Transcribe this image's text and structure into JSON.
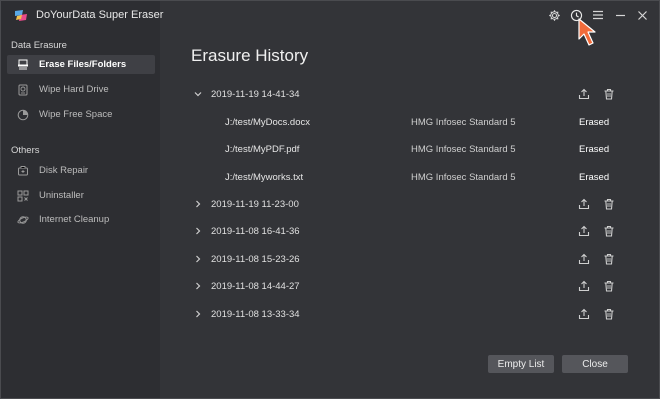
{
  "app": {
    "title": "DoYourData Super Eraser"
  },
  "sidebar": {
    "sections": [
      {
        "label": "Data Erasure"
      },
      {
        "label": "Others"
      }
    ],
    "items": [
      {
        "label": "Erase Files/Folders",
        "icon": "shredder-icon",
        "active": true
      },
      {
        "label": "Wipe Hard Drive",
        "icon": "hard-drive-icon",
        "active": false
      },
      {
        "label": "Wipe Free Space",
        "icon": "pie-chart-icon",
        "active": false
      },
      {
        "label": "Disk Repair",
        "icon": "disk-repair-icon",
        "active": false
      },
      {
        "label": "Uninstaller",
        "icon": "uninstaller-icon",
        "active": false
      },
      {
        "label": "Internet Cleanup",
        "icon": "planet-icon",
        "active": false
      }
    ]
  },
  "main": {
    "title": "Erasure History",
    "groups": [
      {
        "date": "2019-11-19 14-41-34",
        "expanded": true,
        "files": [
          {
            "path": "J:/test/MyDocs.docx",
            "algorithm": "HMG Infosec Standard 5",
            "status": "Erased"
          },
          {
            "path": "J:/test/MyPDF.pdf",
            "algorithm": "HMG Infosec Standard 5",
            "status": "Erased"
          },
          {
            "path": "J:/test/Myworks.txt",
            "algorithm": "HMG Infosec Standard 5",
            "status": "Erased"
          }
        ]
      },
      {
        "date": "2019-11-19 11-23-00",
        "expanded": false
      },
      {
        "date": "2019-11-08 16-41-36",
        "expanded": false
      },
      {
        "date": "2019-11-08 15-23-26",
        "expanded": false
      },
      {
        "date": "2019-11-08 14-44-27",
        "expanded": false
      },
      {
        "date": "2019-11-08 13-33-34",
        "expanded": false
      }
    ],
    "buttons": {
      "empty_list": "Empty List",
      "close": "Close"
    }
  },
  "colors": {
    "window_bg": "#333438",
    "sidebar_bg": "#2d2e32",
    "button_bg": "#55565b",
    "pointer": "#f26b3a"
  }
}
